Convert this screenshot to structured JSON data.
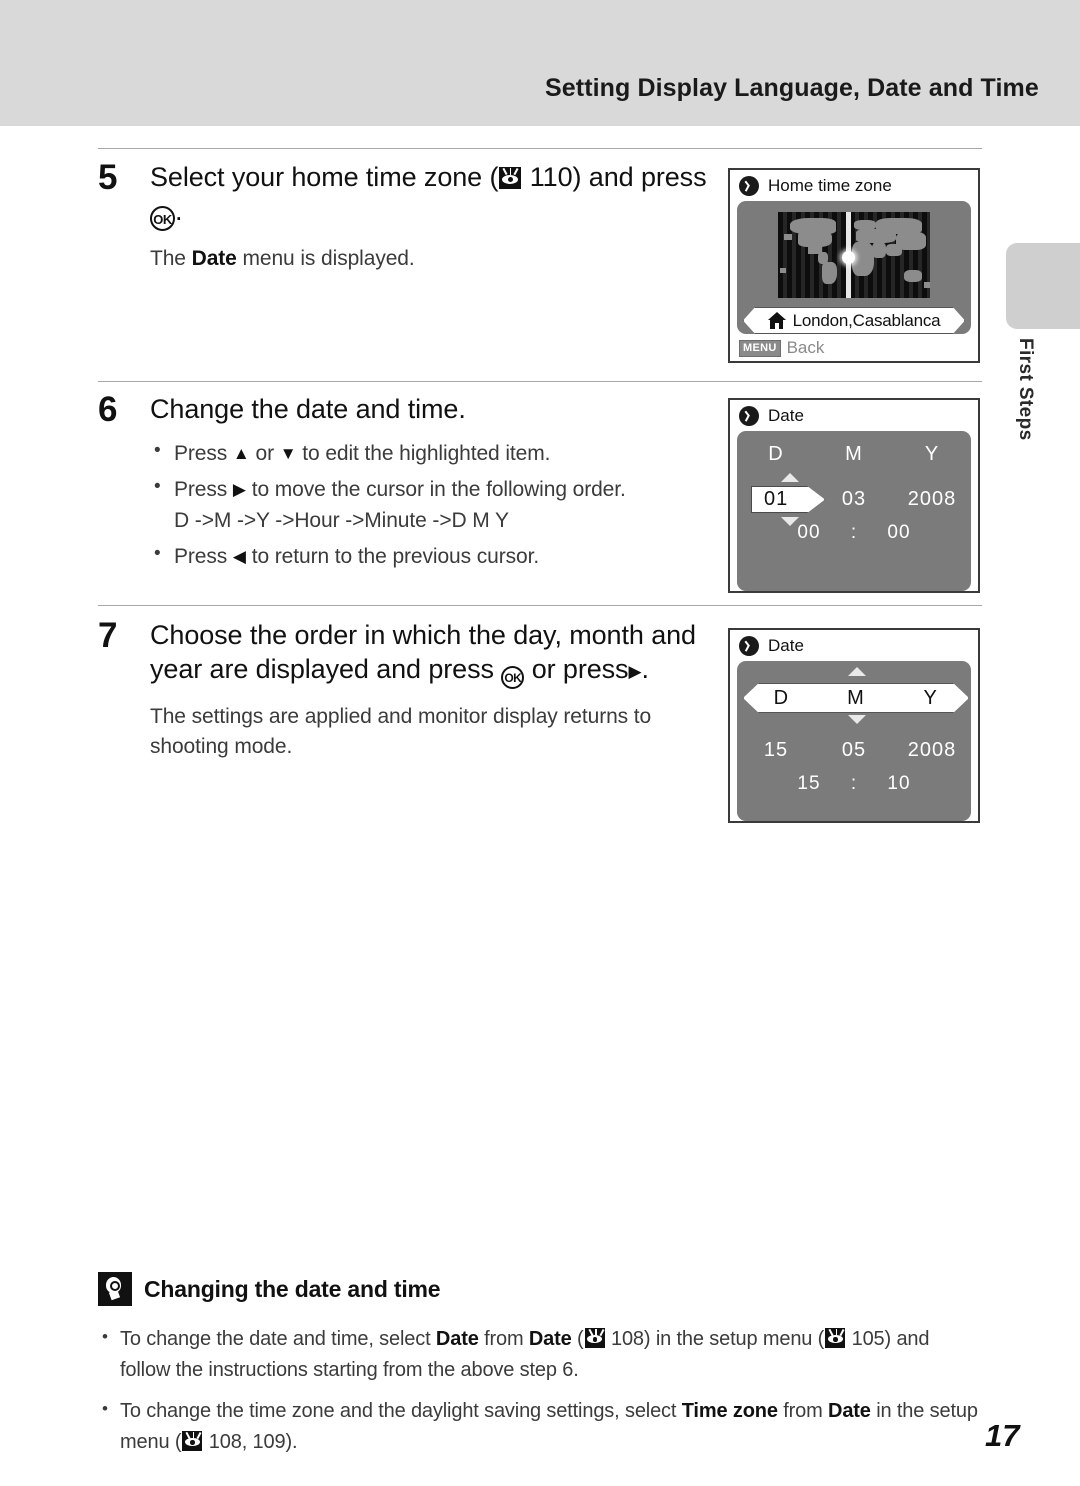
{
  "header": {
    "title": "Setting Display Language, Date and Time"
  },
  "side_tab": {
    "label": "First Steps"
  },
  "steps": [
    {
      "number": "5",
      "heading_a": "Select your home time zone (",
      "heading_page_ref": "110",
      "heading_b": ") and press",
      "heading_c": ".",
      "ok_label": "OK",
      "sub_a": "The ",
      "sub_bold": "Date",
      "sub_b": " menu is displayed."
    },
    {
      "number": "6",
      "heading": "Change the date and time.",
      "bullets": [
        {
          "a": "Press ",
          "glyph1": "▲",
          "b": " or ",
          "glyph2": "▼",
          "c": " to edit the highlighted item."
        },
        {
          "a": "Press ",
          "glyph1": "▶",
          "b": " to move the cursor in the following order.",
          "cont": "D ->M ->Y ->Hour ->Minute ->D M Y"
        },
        {
          "a": "Press ",
          "glyph1": "◀",
          "b": " to return to the previous cursor."
        }
      ]
    },
    {
      "number": "7",
      "heading_a": "Choose the order in which the day, month and year are displayed and press",
      "heading_b": "or press",
      "heading_glyph": "▶",
      "heading_c": ".",
      "ok_label": "OK",
      "sub": "The settings are applied and monitor display returns to shooting mode."
    }
  ],
  "screens": {
    "home_time_zone": {
      "title": "Home time zone",
      "clock_icon": "clock-icon",
      "city": "London,Casablanca",
      "home_icon": "house-icon",
      "menu_chip": "MENU",
      "menu_label": "Back"
    },
    "date_step6": {
      "title": "Date",
      "clock_icon": "clock-icon",
      "headers": [
        "D",
        "M",
        "Y"
      ],
      "values": [
        "01",
        "03",
        "2008"
      ],
      "cursor_value": "01",
      "time": {
        "hour": "00",
        "sep": ":",
        "minute": "00"
      }
    },
    "date_step7": {
      "title": "Date",
      "clock_icon": "clock-icon",
      "headers": [
        "D",
        "M",
        "Y"
      ],
      "values": [
        "15",
        "05",
        "2008"
      ],
      "time": {
        "hour": "15",
        "sep": ":",
        "minute": "10"
      }
    }
  },
  "note": {
    "icon": "lightbulb-icon",
    "title": "Changing the date and time",
    "items": [
      {
        "a": "To change the date and time, select ",
        "b1": "Date",
        "c": " from ",
        "b2": "Date",
        "d": " (",
        "ref1": "108",
        "e": ") in the setup menu (",
        "ref2": "105",
        "f": ") and follow the instructions starting from the above step 6."
      },
      {
        "a": "To change the time zone and the daylight saving settings, select ",
        "b1": "Time zone",
        "c": " from ",
        "b2": "Date",
        "d": " in the setup menu (",
        "ref1": "108, 109",
        "e": ")."
      }
    ]
  },
  "page_number": "17"
}
